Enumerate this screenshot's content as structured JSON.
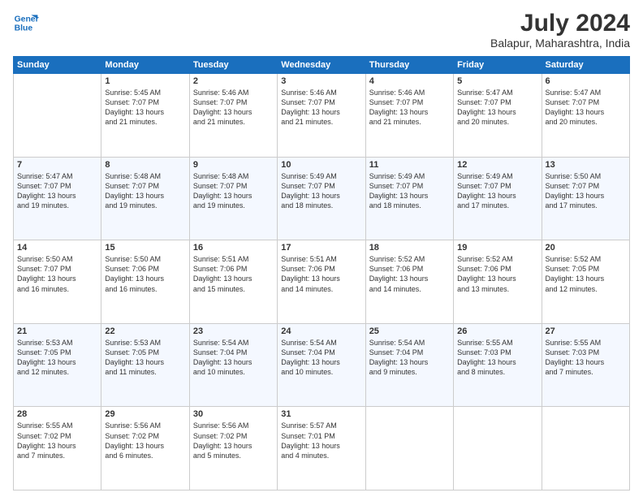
{
  "header": {
    "logo_line1": "General",
    "logo_line2": "Blue",
    "main_title": "July 2024",
    "sub_title": "Balapur, Maharashtra, India"
  },
  "days_of_week": [
    "Sunday",
    "Monday",
    "Tuesday",
    "Wednesday",
    "Thursday",
    "Friday",
    "Saturday"
  ],
  "weeks": [
    [
      {
        "day": "",
        "info": ""
      },
      {
        "day": "1",
        "info": "Sunrise: 5:45 AM\nSunset: 7:07 PM\nDaylight: 13 hours\nand 21 minutes."
      },
      {
        "day": "2",
        "info": "Sunrise: 5:46 AM\nSunset: 7:07 PM\nDaylight: 13 hours\nand 21 minutes."
      },
      {
        "day": "3",
        "info": "Sunrise: 5:46 AM\nSunset: 7:07 PM\nDaylight: 13 hours\nand 21 minutes."
      },
      {
        "day": "4",
        "info": "Sunrise: 5:46 AM\nSunset: 7:07 PM\nDaylight: 13 hours\nand 21 minutes."
      },
      {
        "day": "5",
        "info": "Sunrise: 5:47 AM\nSunset: 7:07 PM\nDaylight: 13 hours\nand 20 minutes."
      },
      {
        "day": "6",
        "info": "Sunrise: 5:47 AM\nSunset: 7:07 PM\nDaylight: 13 hours\nand 20 minutes."
      }
    ],
    [
      {
        "day": "7",
        "info": "Sunrise: 5:47 AM\nSunset: 7:07 PM\nDaylight: 13 hours\nand 19 minutes."
      },
      {
        "day": "8",
        "info": "Sunrise: 5:48 AM\nSunset: 7:07 PM\nDaylight: 13 hours\nand 19 minutes."
      },
      {
        "day": "9",
        "info": "Sunrise: 5:48 AM\nSunset: 7:07 PM\nDaylight: 13 hours\nand 19 minutes."
      },
      {
        "day": "10",
        "info": "Sunrise: 5:49 AM\nSunset: 7:07 PM\nDaylight: 13 hours\nand 18 minutes."
      },
      {
        "day": "11",
        "info": "Sunrise: 5:49 AM\nSunset: 7:07 PM\nDaylight: 13 hours\nand 18 minutes."
      },
      {
        "day": "12",
        "info": "Sunrise: 5:49 AM\nSunset: 7:07 PM\nDaylight: 13 hours\nand 17 minutes."
      },
      {
        "day": "13",
        "info": "Sunrise: 5:50 AM\nSunset: 7:07 PM\nDaylight: 13 hours\nand 17 minutes."
      }
    ],
    [
      {
        "day": "14",
        "info": "Sunrise: 5:50 AM\nSunset: 7:07 PM\nDaylight: 13 hours\nand 16 minutes."
      },
      {
        "day": "15",
        "info": "Sunrise: 5:50 AM\nSunset: 7:06 PM\nDaylight: 13 hours\nand 16 minutes."
      },
      {
        "day": "16",
        "info": "Sunrise: 5:51 AM\nSunset: 7:06 PM\nDaylight: 13 hours\nand 15 minutes."
      },
      {
        "day": "17",
        "info": "Sunrise: 5:51 AM\nSunset: 7:06 PM\nDaylight: 13 hours\nand 14 minutes."
      },
      {
        "day": "18",
        "info": "Sunrise: 5:52 AM\nSunset: 7:06 PM\nDaylight: 13 hours\nand 14 minutes."
      },
      {
        "day": "19",
        "info": "Sunrise: 5:52 AM\nSunset: 7:06 PM\nDaylight: 13 hours\nand 13 minutes."
      },
      {
        "day": "20",
        "info": "Sunrise: 5:52 AM\nSunset: 7:05 PM\nDaylight: 13 hours\nand 12 minutes."
      }
    ],
    [
      {
        "day": "21",
        "info": "Sunrise: 5:53 AM\nSunset: 7:05 PM\nDaylight: 13 hours\nand 12 minutes."
      },
      {
        "day": "22",
        "info": "Sunrise: 5:53 AM\nSunset: 7:05 PM\nDaylight: 13 hours\nand 11 minutes."
      },
      {
        "day": "23",
        "info": "Sunrise: 5:54 AM\nSunset: 7:04 PM\nDaylight: 13 hours\nand 10 minutes."
      },
      {
        "day": "24",
        "info": "Sunrise: 5:54 AM\nSunset: 7:04 PM\nDaylight: 13 hours\nand 10 minutes."
      },
      {
        "day": "25",
        "info": "Sunrise: 5:54 AM\nSunset: 7:04 PM\nDaylight: 13 hours\nand 9 minutes."
      },
      {
        "day": "26",
        "info": "Sunrise: 5:55 AM\nSunset: 7:03 PM\nDaylight: 13 hours\nand 8 minutes."
      },
      {
        "day": "27",
        "info": "Sunrise: 5:55 AM\nSunset: 7:03 PM\nDaylight: 13 hours\nand 7 minutes."
      }
    ],
    [
      {
        "day": "28",
        "info": "Sunrise: 5:55 AM\nSunset: 7:02 PM\nDaylight: 13 hours\nand 7 minutes."
      },
      {
        "day": "29",
        "info": "Sunrise: 5:56 AM\nSunset: 7:02 PM\nDaylight: 13 hours\nand 6 minutes."
      },
      {
        "day": "30",
        "info": "Sunrise: 5:56 AM\nSunset: 7:02 PM\nDaylight: 13 hours\nand 5 minutes."
      },
      {
        "day": "31",
        "info": "Sunrise: 5:57 AM\nSunset: 7:01 PM\nDaylight: 13 hours\nand 4 minutes."
      },
      {
        "day": "",
        "info": ""
      },
      {
        "day": "",
        "info": ""
      },
      {
        "day": "",
        "info": ""
      }
    ]
  ]
}
